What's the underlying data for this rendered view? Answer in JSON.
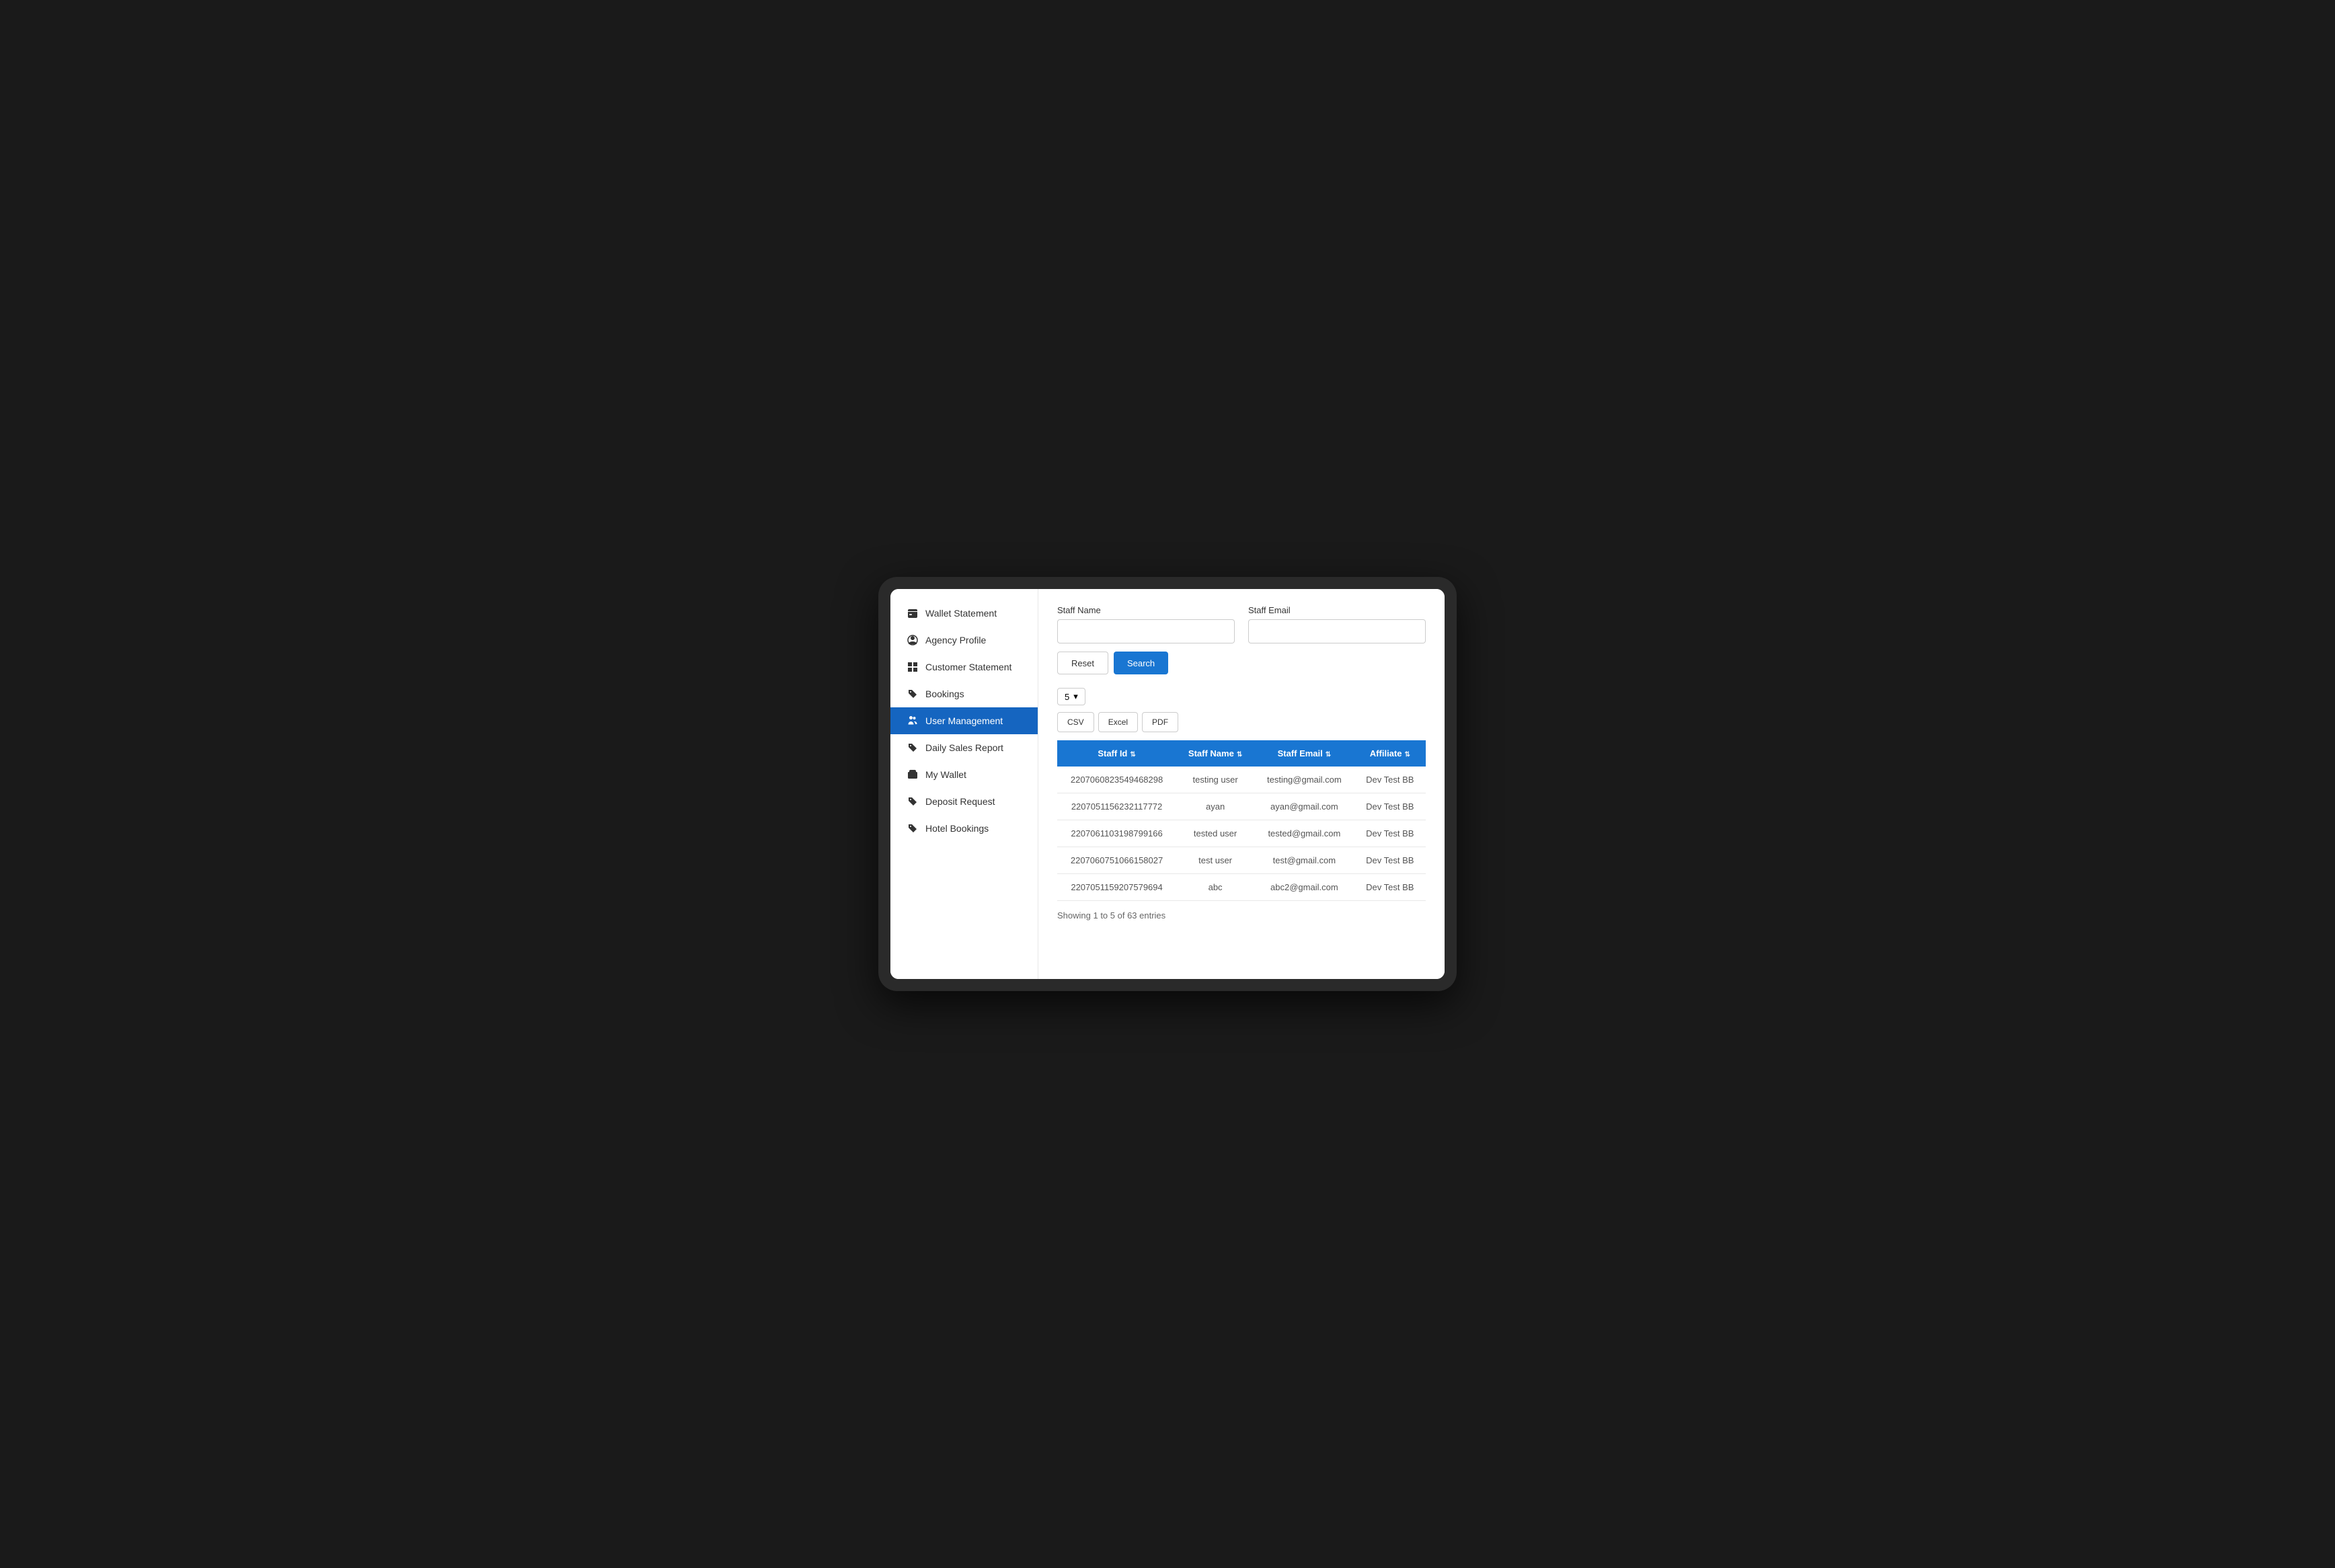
{
  "sidebar": {
    "items": [
      {
        "id": "wallet-statement",
        "label": "Wallet Statement",
        "icon": "wallet",
        "active": false
      },
      {
        "id": "agency-profile",
        "label": "Agency Profile",
        "icon": "person-circle",
        "active": false
      },
      {
        "id": "customer-statement",
        "label": "Customer Statement",
        "icon": "grid",
        "active": false
      },
      {
        "id": "bookings",
        "label": "Bookings",
        "icon": "tag",
        "active": false
      },
      {
        "id": "user-management",
        "label": "User Management",
        "icon": "person-group",
        "active": true
      },
      {
        "id": "daily-sales-report",
        "label": "Daily Sales Report",
        "icon": "tag",
        "active": false
      },
      {
        "id": "my-wallet",
        "label": "My Wallet",
        "icon": "wallet2",
        "active": false
      },
      {
        "id": "deposit-request",
        "label": "Deposit Request",
        "icon": "tag2",
        "active": false
      },
      {
        "id": "hotel-bookings",
        "label": "Hotel Bookings",
        "icon": "tag3",
        "active": false
      }
    ]
  },
  "search_form": {
    "staff_name_label": "Staff Name",
    "staff_name_placeholder": "",
    "staff_email_label": "Staff Email",
    "staff_email_placeholder": "",
    "reset_button": "Reset",
    "search_button": "Search"
  },
  "table_controls": {
    "per_page_value": "5",
    "export_buttons": [
      "CSV",
      "Excel",
      "PDF"
    ]
  },
  "table": {
    "columns": [
      {
        "id": "staff-id",
        "label": "Staff Id",
        "sortable": true
      },
      {
        "id": "staff-name",
        "label": "Staff Name",
        "sortable": true
      },
      {
        "id": "staff-email",
        "label": "Staff Email",
        "sortable": true
      },
      {
        "id": "affiliate",
        "label": "Affiliate",
        "sortable": true
      }
    ],
    "rows": [
      {
        "id": "220706082354946829​8",
        "name": "testing user",
        "email": "testing@gmail.com",
        "affiliate": "Dev Test BB"
      },
      {
        "id": "220705115623211777​2",
        "name": "ayan",
        "email": "ayan@gmail.com",
        "affiliate": "Dev Test BB"
      },
      {
        "id": "220706110319879916​6",
        "name": "tested user",
        "email": "tested@gmail.com",
        "affiliate": "Dev Test BB"
      },
      {
        "id": "220706075106615802​7",
        "name": "test user",
        "email": "test@gmail.com",
        "affiliate": "Dev Test BB"
      },
      {
        "id": "220705115920757969​4",
        "name": "abc",
        "email": "abc2@gmail.com",
        "affiliate": "Dev Test BB"
      }
    ],
    "footer": "Showing 1 to 5 of 63 entries"
  }
}
